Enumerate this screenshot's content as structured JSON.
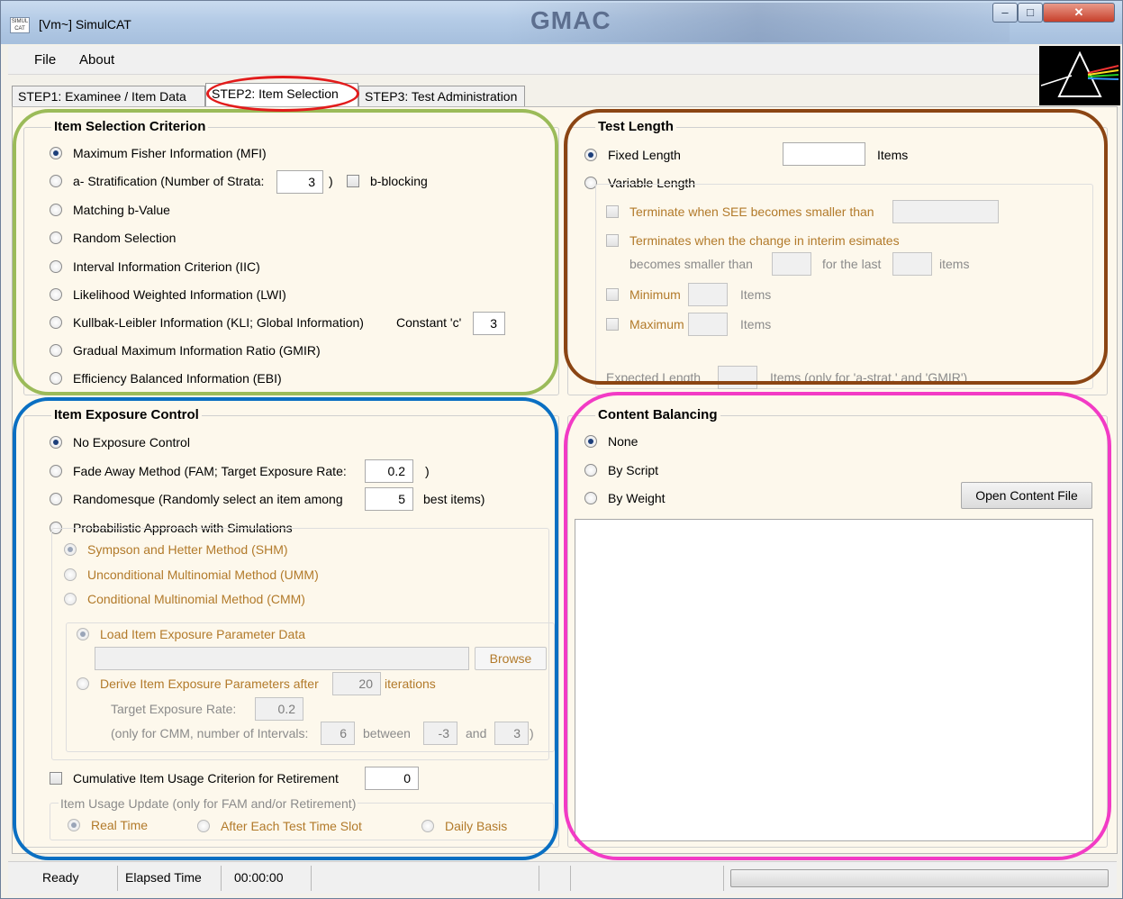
{
  "window": {
    "title": "[Vm~] SimulCAT",
    "icon_label": "SIMUL CAT",
    "background_logo": "GMAC"
  },
  "menu": {
    "file": "File",
    "about": "About"
  },
  "tabs": [
    "STEP1: Examinee / Item Data",
    "STEP2: Item Selection",
    "STEP3: Test Administration"
  ],
  "item_selection": {
    "title": "Item Selection Criterion",
    "options": [
      "Maximum Fisher Information (MFI)",
      "a- Stratification (Number of Strata:",
      "Matching b-Value",
      "Random Selection",
      "Interval Information Criterion (IIC)",
      "Likelihood Weighted Information (LWI)",
      "Kullbak-Leibler Information (KLI; Global Information)",
      "Gradual Maximum Information Ratio (GMIR)",
      "Efficiency Balanced Information (EBI)"
    ],
    "selected": "Maximum Fisher Information (MFI)",
    "strata_value": "3",
    "strata_close": ")",
    "b_blocking": "b-blocking",
    "constant_label": "Constant 'c'",
    "constant_value": "3"
  },
  "test_length": {
    "title": "Test Length",
    "fixed": "Fixed Length",
    "fixed_value": "",
    "items": "Items",
    "variable": "Variable Length",
    "see_label": "Terminate when SEE becomes smaller than",
    "change_label": "Terminates when the change in interim esimates",
    "smaller_than": "becomes smaller than",
    "for_last": "for the last",
    "items_lower": "items",
    "minimum": "Minimum",
    "maximum": "Maximum",
    "items2": "Items",
    "expected_label": "Expected Length",
    "expected_note": "Items  (only for 'a-strat.' and 'GMIR')"
  },
  "exposure": {
    "title": "Item Exposure Control",
    "no_control": "No Exposure Control",
    "fam": "Fade Away Method (FAM; Target Exposure Rate:",
    "fam_value": "0.2",
    "fam_close": ")",
    "randomesque": "Randomesque (Randomly select an item among",
    "randomesque_value": "5",
    "best_items": "best items)",
    "probabilistic": "Probabilistic Approach with Simulations",
    "shm": "Sympson and Hetter Method (SHM)",
    "umm": "Unconditional Multinomial Method (UMM)",
    "cmm": "Conditional Multinomial Method (CMM)",
    "load": "Load Item Exposure Parameter Data",
    "browse": "Browse",
    "derive": "Derive Item Exposure Parameters after",
    "iterations_value": "20",
    "iterations": "iterations",
    "target_rate": "Target Exposure Rate:",
    "target_value": "0.2",
    "cmm_note": "(only for CMM, number of Intervals:",
    "intervals_value": "6",
    "between": "between",
    "low_value": "-3",
    "and": "and",
    "high_value": "3",
    "paren_close": ")",
    "cumulative": "Cumulative Item Usage Criterion for Retirement",
    "cumulative_value": "0",
    "usage_update": "Item Usage Update (only for FAM and/or Retirement)",
    "real_time": "Real Time",
    "after_slot": "After Each Test Time Slot",
    "daily": "Daily Basis"
  },
  "content_balancing": {
    "title": "Content Balancing",
    "none": "None",
    "by_script": "By Script",
    "by_weight": "By Weight",
    "open_file": "Open Content File"
  },
  "status": {
    "ready": "Ready",
    "elapsed_label": "Elapsed Time",
    "elapsed_value": "00:00:00"
  },
  "colors": {
    "annot_green": "#9bbb59",
    "annot_red": "#e21b1b",
    "annot_brown": "#8b4513",
    "annot_blue": "#0a6fc2",
    "annot_pink": "#f23bc5"
  }
}
